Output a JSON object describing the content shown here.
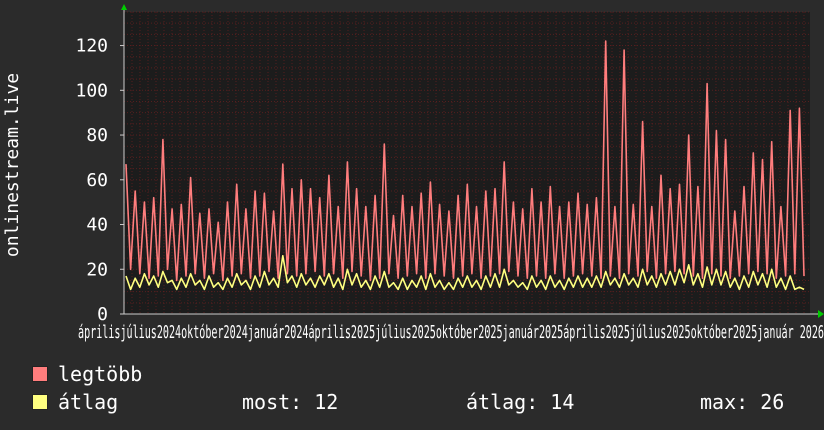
{
  "chart_data": {
    "type": "line",
    "ylabel": "onlinestream.live",
    "ylim": [
      0,
      135
    ],
    "y_ticks": [
      0,
      20,
      40,
      60,
      80,
      100,
      120
    ],
    "x_ticks": [
      "április",
      "július",
      "2024",
      "október",
      "2024",
      "január",
      "2024",
      "április",
      "2025",
      "július",
      "2025",
      "október",
      "2025",
      "január",
      "2025",
      "április",
      "2025",
      "július",
      "2025",
      "október",
      "2025",
      "január",
      "2026"
    ],
    "x_axis_text": "áprilisjúlius2024október2024január2024április2025július2025október2025január2025április2025július2025október2025január 2026",
    "grid": true,
    "colors": {
      "max": "#ff7d7d",
      "avg": "#ffff80",
      "background": "#1c1c1c",
      "grid": "#6e2020",
      "axis": "#cccccc",
      "arrow": "#00cc00"
    },
    "series": [
      {
        "name": "legtöbb",
        "values": [
          67,
          20,
          55,
          18,
          50,
          16,
          52,
          17,
          78,
          20,
          47,
          15,
          49,
          17,
          61,
          18,
          45,
          16,
          47,
          18,
          41,
          15,
          50,
          17,
          58,
          18,
          47,
          16,
          55,
          17,
          54,
          19,
          46,
          16,
          67,
          18,
          56,
          17,
          60,
          18,
          56,
          19,
          52,
          17,
          62,
          18,
          48,
          16,
          68,
          19,
          56,
          17,
          48,
          15,
          53,
          16,
          76,
          18,
          44,
          16,
          53,
          17,
          48,
          18,
          54,
          16,
          59,
          18,
          49,
          17,
          46,
          16,
          53,
          17,
          58,
          18,
          48,
          16,
          55,
          17,
          56,
          18,
          68,
          19,
          50,
          17,
          47,
          16,
          56,
          17,
          50,
          16,
          57,
          18,
          48,
          16,
          50,
          17,
          54,
          18,
          49,
          17,
          52,
          16,
          122,
          17,
          48,
          16,
          118,
          18,
          49,
          17,
          86,
          19,
          48,
          16,
          62,
          18,
          56,
          19,
          58,
          18,
          80,
          17,
          57,
          16,
          103,
          18,
          82,
          17,
          78,
          16,
          46,
          17,
          57,
          18,
          72,
          19,
          69,
          18,
          77,
          16,
          48,
          17,
          91,
          18,
          92,
          17
        ],
        "color": "#ff7d7d"
      },
      {
        "name": "átlag",
        "values": [
          17,
          11,
          16,
          12,
          18,
          13,
          17,
          12,
          19,
          14,
          15,
          11,
          16,
          12,
          18,
          13,
          15,
          11,
          17,
          12,
          14,
          11,
          16,
          12,
          18,
          13,
          15,
          11,
          17,
          12,
          19,
          13,
          16,
          12,
          26,
          14,
          17,
          12,
          18,
          13,
          16,
          12,
          17,
          13,
          18,
          12,
          16,
          11,
          20,
          13,
          18,
          12,
          15,
          11,
          17,
          12,
          19,
          12,
          14,
          11,
          16,
          11,
          15,
          12,
          17,
          11,
          18,
          12,
          15,
          11,
          14,
          11,
          16,
          12,
          17,
          12,
          15,
          11,
          17,
          12,
          18,
          12,
          20,
          13,
          15,
          12,
          14,
          11,
          17,
          12,
          15,
          11,
          17,
          12,
          15,
          11,
          16,
          12,
          17,
          12,
          16,
          12,
          17,
          12,
          19,
          13,
          16,
          12,
          18,
          13,
          16,
          12,
          20,
          13,
          17,
          12,
          18,
          13,
          19,
          13,
          20,
          14,
          22,
          13,
          18,
          12,
          21,
          13,
          20,
          13,
          19,
          12,
          16,
          11,
          17,
          12,
          19,
          13,
          18,
          12,
          20,
          12,
          16,
          11,
          17,
          11,
          12,
          11
        ],
        "color": "#ffff80"
      }
    ]
  },
  "legend": {
    "items": [
      {
        "label": "legtöbb",
        "color": "#ff7d7d"
      },
      {
        "label": "átlag",
        "color": "#ffff80"
      }
    ],
    "stats": {
      "now": "most: 12",
      "avg": "átlag: 14",
      "max": "max: 26"
    }
  }
}
